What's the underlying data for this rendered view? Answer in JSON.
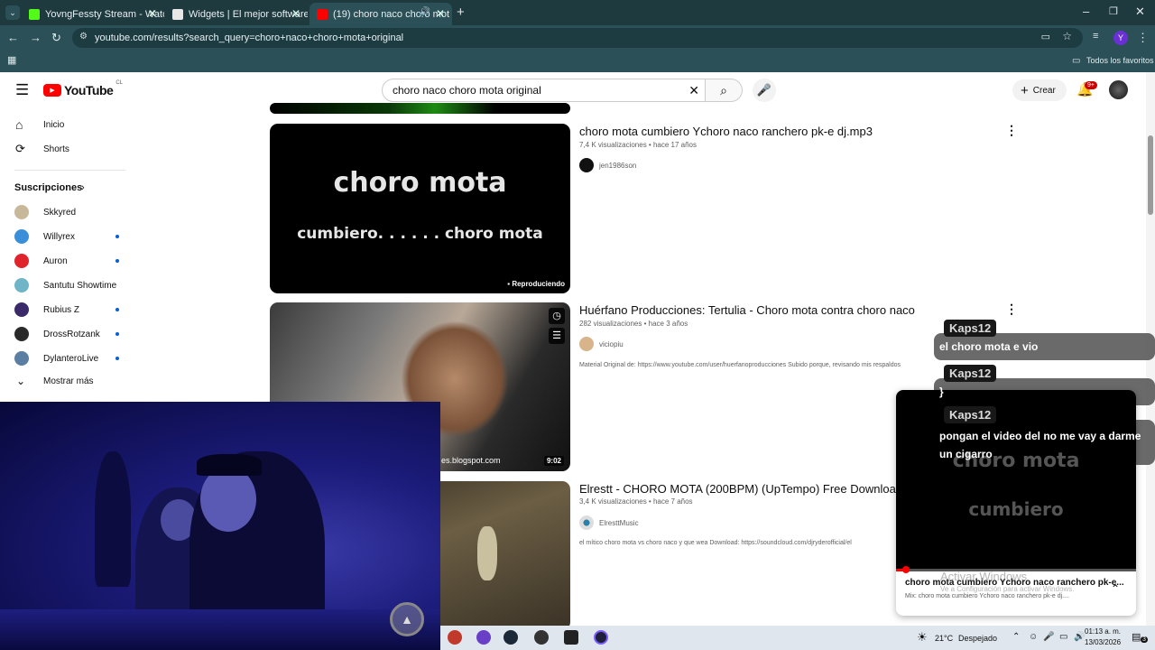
{
  "browser": {
    "tabs": [
      {
        "label": "YovngFessty Stream - Watch Li",
        "active": false
      },
      {
        "label": "Widgets | El mejor software par",
        "active": false
      },
      {
        "label": "(19) choro naco choro mot",
        "active": true
      }
    ],
    "url": "youtube.com/results?search_query=choro+naco+choro+mota+original",
    "bookmarks_label": "Todos los favoritos"
  },
  "youtube": {
    "logo": "YouTube",
    "country": "CL",
    "search_value": "choro naco choro mota original",
    "create_label": "Crear",
    "notif_badge": "9+",
    "sidebar": {
      "home": "Inicio",
      "shorts": "Shorts",
      "subs_heading": "Suscripciones",
      "subs": [
        {
          "name": "Skkyred",
          "dot": false
        },
        {
          "name": "Willyrex",
          "dot": true
        },
        {
          "name": "Auron",
          "dot": true
        },
        {
          "name": "Santutu Showtime",
          "dot": false
        },
        {
          "name": "Rubius Z",
          "dot": true
        },
        {
          "name": "DrossRotzank",
          "dot": true
        },
        {
          "name": "DylanteroLive",
          "dot": true
        }
      ],
      "more": "Mostrar más"
    },
    "results": [
      {
        "title": "choro mota cumbiero Ychoro naco ranchero pk-e dj.mp3",
        "meta": "7,4 K visualizaciones • hace 17 años",
        "channel": "jen1986son",
        "thumb_line1": "choro mota",
        "thumb_line2": "cumbiero. . . . . . choro mota",
        "status": "Reproduciendo"
      },
      {
        "title": "Huérfano Producciones: Tertulia - Choro mota contra choro naco",
        "meta": "282 visualizaciones • hace 3 años",
        "channel": "viciopiu",
        "desc": "Material Original de: https://www.youtube.com/user/huerfanoproducciones Subido porque, revisando mis respaldos",
        "thumb_text": "es.blogspot.com",
        "duration": "9:02"
      },
      {
        "title": "Elrestt - CHORO MOTA (200BPM) (UpTempo) Free Download",
        "meta": "3,4 K visualizaciones • hace 7 años",
        "channel": "ElresttMusic",
        "desc": "el mítico choro mota vs choro naco y que wea Download: https://soundcloud.com/djryderofficial/el"
      }
    ]
  },
  "chat": [
    {
      "user": "Kaps12",
      "message": "el choro mota e vio"
    },
    {
      "user": "Kaps12",
      "message": "}"
    },
    {
      "user": "Kaps12",
      "message": "pongan el video del no me vay a darme un cigarro"
    }
  ],
  "miniplayer": {
    "thumb_line1": "choro mota",
    "thumb_line2": "cumbiero",
    "title": "choro mota cumbiero Ychoro naco ranchero pk-e...",
    "subtitle": "Mix: choro mota cumbiero Ychoro naco ranchero pk-e dj...."
  },
  "watermark": {
    "line1": "Activar Windows",
    "line2": "Ve a Configuración para activar Windows."
  },
  "taskbar": {
    "weather": "21°C",
    "weather_text": "Despejado",
    "time": "01:13 a. m.",
    "date": "13/03/2026",
    "notif": "3"
  }
}
